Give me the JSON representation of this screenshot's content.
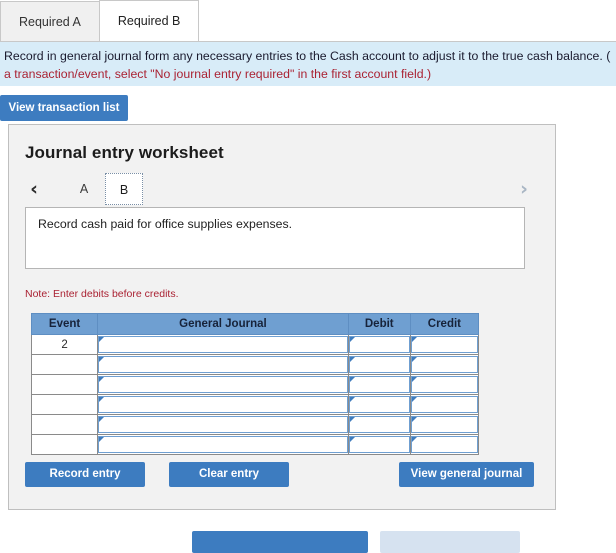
{
  "tabs": [
    {
      "label": "Required A",
      "active": false
    },
    {
      "label": "Required B",
      "active": true
    }
  ],
  "banner": {
    "line1": "Record in general journal form any necessary entries to the Cash account to adjust it to the true cash balance. (",
    "line2": "a transaction/event, select \"No journal entry required\" in the first account field.)"
  },
  "toolbar": {
    "view_transaction_list_label": "View transaction list"
  },
  "worksheet": {
    "title": "Journal entry worksheet",
    "prev_icon": "‹",
    "next_icon": "›",
    "nav_tabs": [
      {
        "label": "A",
        "active": false
      },
      {
        "label": "B",
        "active": true
      }
    ],
    "description": "Record cash paid for office supplies expenses.",
    "note": "Note: Enter debits before credits."
  },
  "table": {
    "headers": [
      "Event",
      "General Journal",
      "Debit",
      "Credit"
    ],
    "rows": [
      {
        "event": "2",
        "general_journal": "",
        "debit": "",
        "credit": ""
      },
      {
        "event": "",
        "general_journal": "",
        "debit": "",
        "credit": ""
      },
      {
        "event": "",
        "general_journal": "",
        "debit": "",
        "credit": ""
      },
      {
        "event": "",
        "general_journal": "",
        "debit": "",
        "credit": ""
      },
      {
        "event": "",
        "general_journal": "",
        "debit": "",
        "credit": ""
      },
      {
        "event": "",
        "general_journal": "",
        "debit": "",
        "credit": ""
      }
    ]
  },
  "actions": {
    "record_entry_label": "Record entry",
    "clear_entry_label": "Clear entry",
    "view_general_journal_label": "View general journal"
  },
  "bottom_bar": {
    "primary_label": "",
    "secondary_label": ""
  },
  "colors": {
    "accent_blue": "#3d7cc0",
    "table_header_blue": "#6f9fd1",
    "banner_blue": "#d8ecf8",
    "note_red": "#aa2233",
    "panel_grey": "#f2f2f2"
  }
}
